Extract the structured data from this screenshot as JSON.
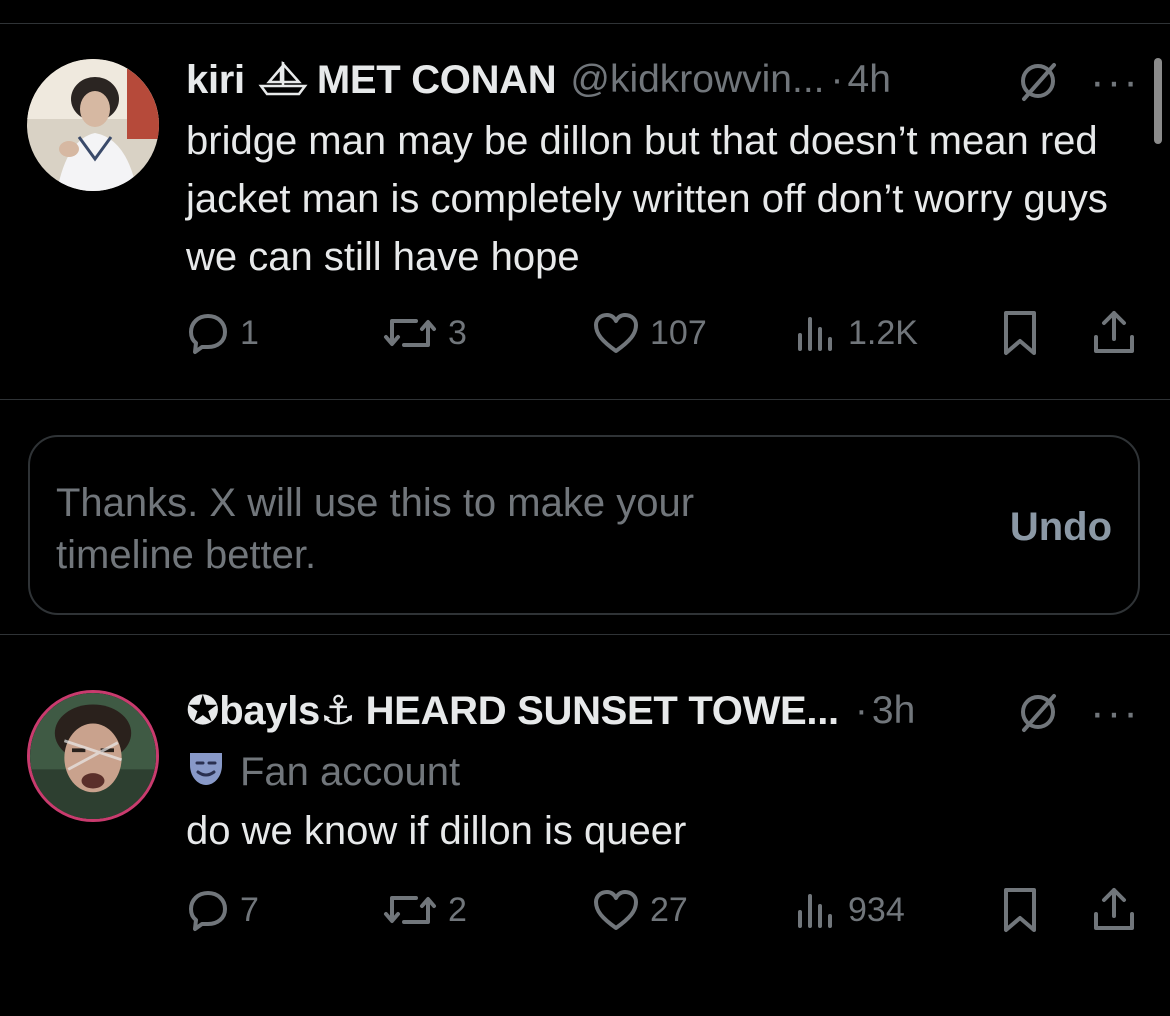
{
  "tweets": [
    {
      "display_name": "kiri",
      "display_name_suffix": "MET CONAN",
      "handle": "@kidkrowvin...",
      "time": "4h",
      "text": "bridge man may be dillon but that doesn’t mean red jacket man is completely written off don’t worry guys we can still have hope",
      "replies": "1",
      "reposts": "3",
      "likes": "107",
      "views": "1.2K"
    },
    {
      "display_name": "✪bayls⚓",
      "display_name_suffix": "HEARD SUNSET TOWE...",
      "time": "3h",
      "badge": "Fan account",
      "text": "do we know if dillon is queer",
      "replies": "7",
      "reposts": "2",
      "likes": "27",
      "views": "934"
    }
  ],
  "feedback": {
    "message": "Thanks. X will use this to make your timeline better.",
    "undo_label": "Undo"
  },
  "more_label": "···",
  "dot_separator": "·",
  "icons": {
    "reply": "reply-icon",
    "repost": "repost-icon",
    "like": "like-icon",
    "views": "views-icon",
    "bookmark": "bookmark-icon",
    "share": "share-icon",
    "grok": "grok-icon",
    "ship": "ship-emoji-icon",
    "mask": "mask-emoji-icon"
  },
  "colors": {
    "background": "#000000",
    "text": "#e7e9ea",
    "muted": "#71767b",
    "border": "#2f3336"
  }
}
